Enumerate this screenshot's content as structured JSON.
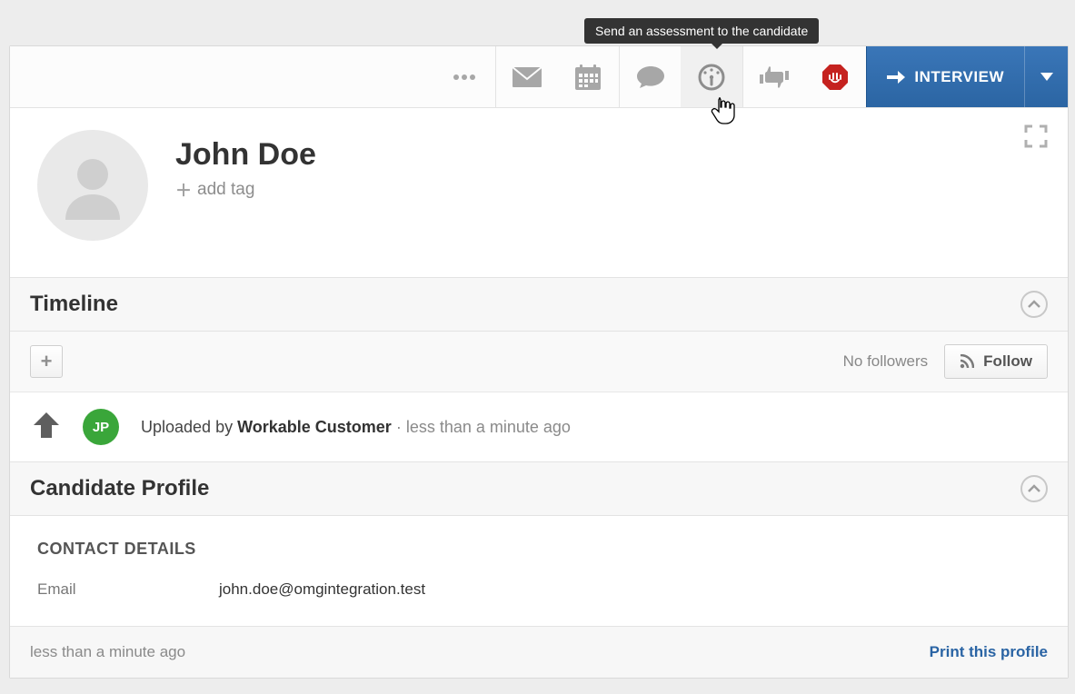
{
  "tooltip": {
    "text": "Send an assessment to the candidate"
  },
  "toolbar": {
    "stage_label": "INTERVIEW"
  },
  "candidate": {
    "name": "John Doe",
    "add_tag_label": "add tag"
  },
  "sections": {
    "timeline_title": "Timeline",
    "profile_title": "Candidate Profile"
  },
  "followers": {
    "none_label": "No followers",
    "follow_label": "Follow"
  },
  "timeline": {
    "badge_initials": "JP",
    "prefix": "Uploaded by",
    "uploader": "Workable Customer",
    "ago": "less than a minute ago"
  },
  "profile": {
    "contact_heading": "CONTACT DETAILS",
    "email_label": "Email",
    "email_value": "john.doe@omgintegration.test"
  },
  "footer": {
    "time": "less than a minute ago",
    "print_label": "Print this profile"
  }
}
